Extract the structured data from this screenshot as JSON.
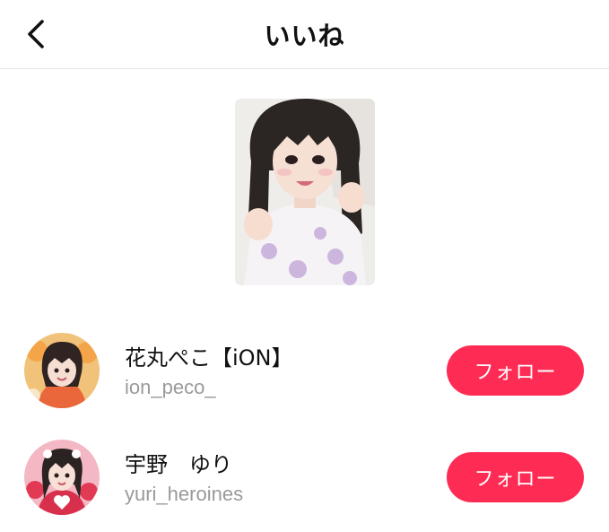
{
  "header": {
    "title": "いいね",
    "back_icon": "chevron-left-icon"
  },
  "post": {
    "thumbnail": "girl-photo-thumbnail"
  },
  "users": [
    {
      "display_name": "花丸ぺこ【iON】",
      "username": "ion_peco_",
      "follow_label": "フォロー"
    },
    {
      "display_name": "宇野　ゆり",
      "username": "yuri_heroines",
      "follow_label": "フォロー"
    }
  ],
  "colors": {
    "accent": "#fe2c55",
    "secondary_text": "#9a9a9a",
    "divider": "#e6e6e6"
  }
}
